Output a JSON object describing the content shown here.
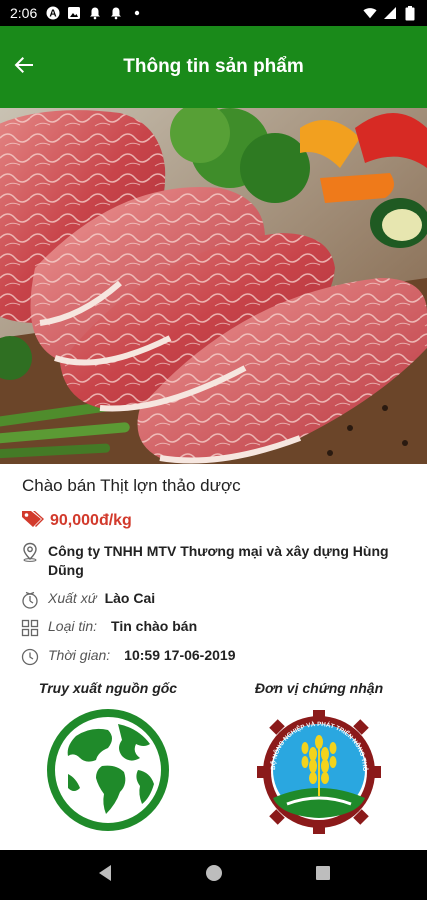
{
  "status_bar": {
    "time": "2:06",
    "icons": [
      "a-circle-icon",
      "image-icon",
      "bell-icon",
      "bell-icon",
      "dot-icon",
      "wifi-icon",
      "cellular-signal-icon",
      "battery-icon"
    ]
  },
  "app_bar": {
    "title": "Thông tin sản phẩm",
    "back_icon": "arrow-left-icon"
  },
  "product": {
    "title": "Chào bán Thịt lợn thảo dược",
    "price": "90,000đ/kg",
    "company": "Công ty TNHH MTV Thương mại và xây dựng Hùng Dũng",
    "origin_label": "Xuất xứ",
    "origin_value": "Lào Cai",
    "type_label": "Loại tin:",
    "type_value": "Tin chào bán",
    "time_label": "Thời gian:",
    "time_value": "10:59 17-06-2019"
  },
  "certification": {
    "traceability_heading": "Truy xuất nguồn gốc",
    "certifier_heading": "Đơn vị chứng nhận",
    "certifier_logo_text": "BỘ NÔNG NGHIỆP VÀ PHÁT TRIỂN NÔNG THÔN"
  },
  "colors": {
    "app_bar": "#1a8a1a",
    "price": "#d23a2c",
    "globe": "#1f8a2a",
    "logo_blue": "#2aa7e0",
    "logo_gear": "#8b1a1a"
  }
}
